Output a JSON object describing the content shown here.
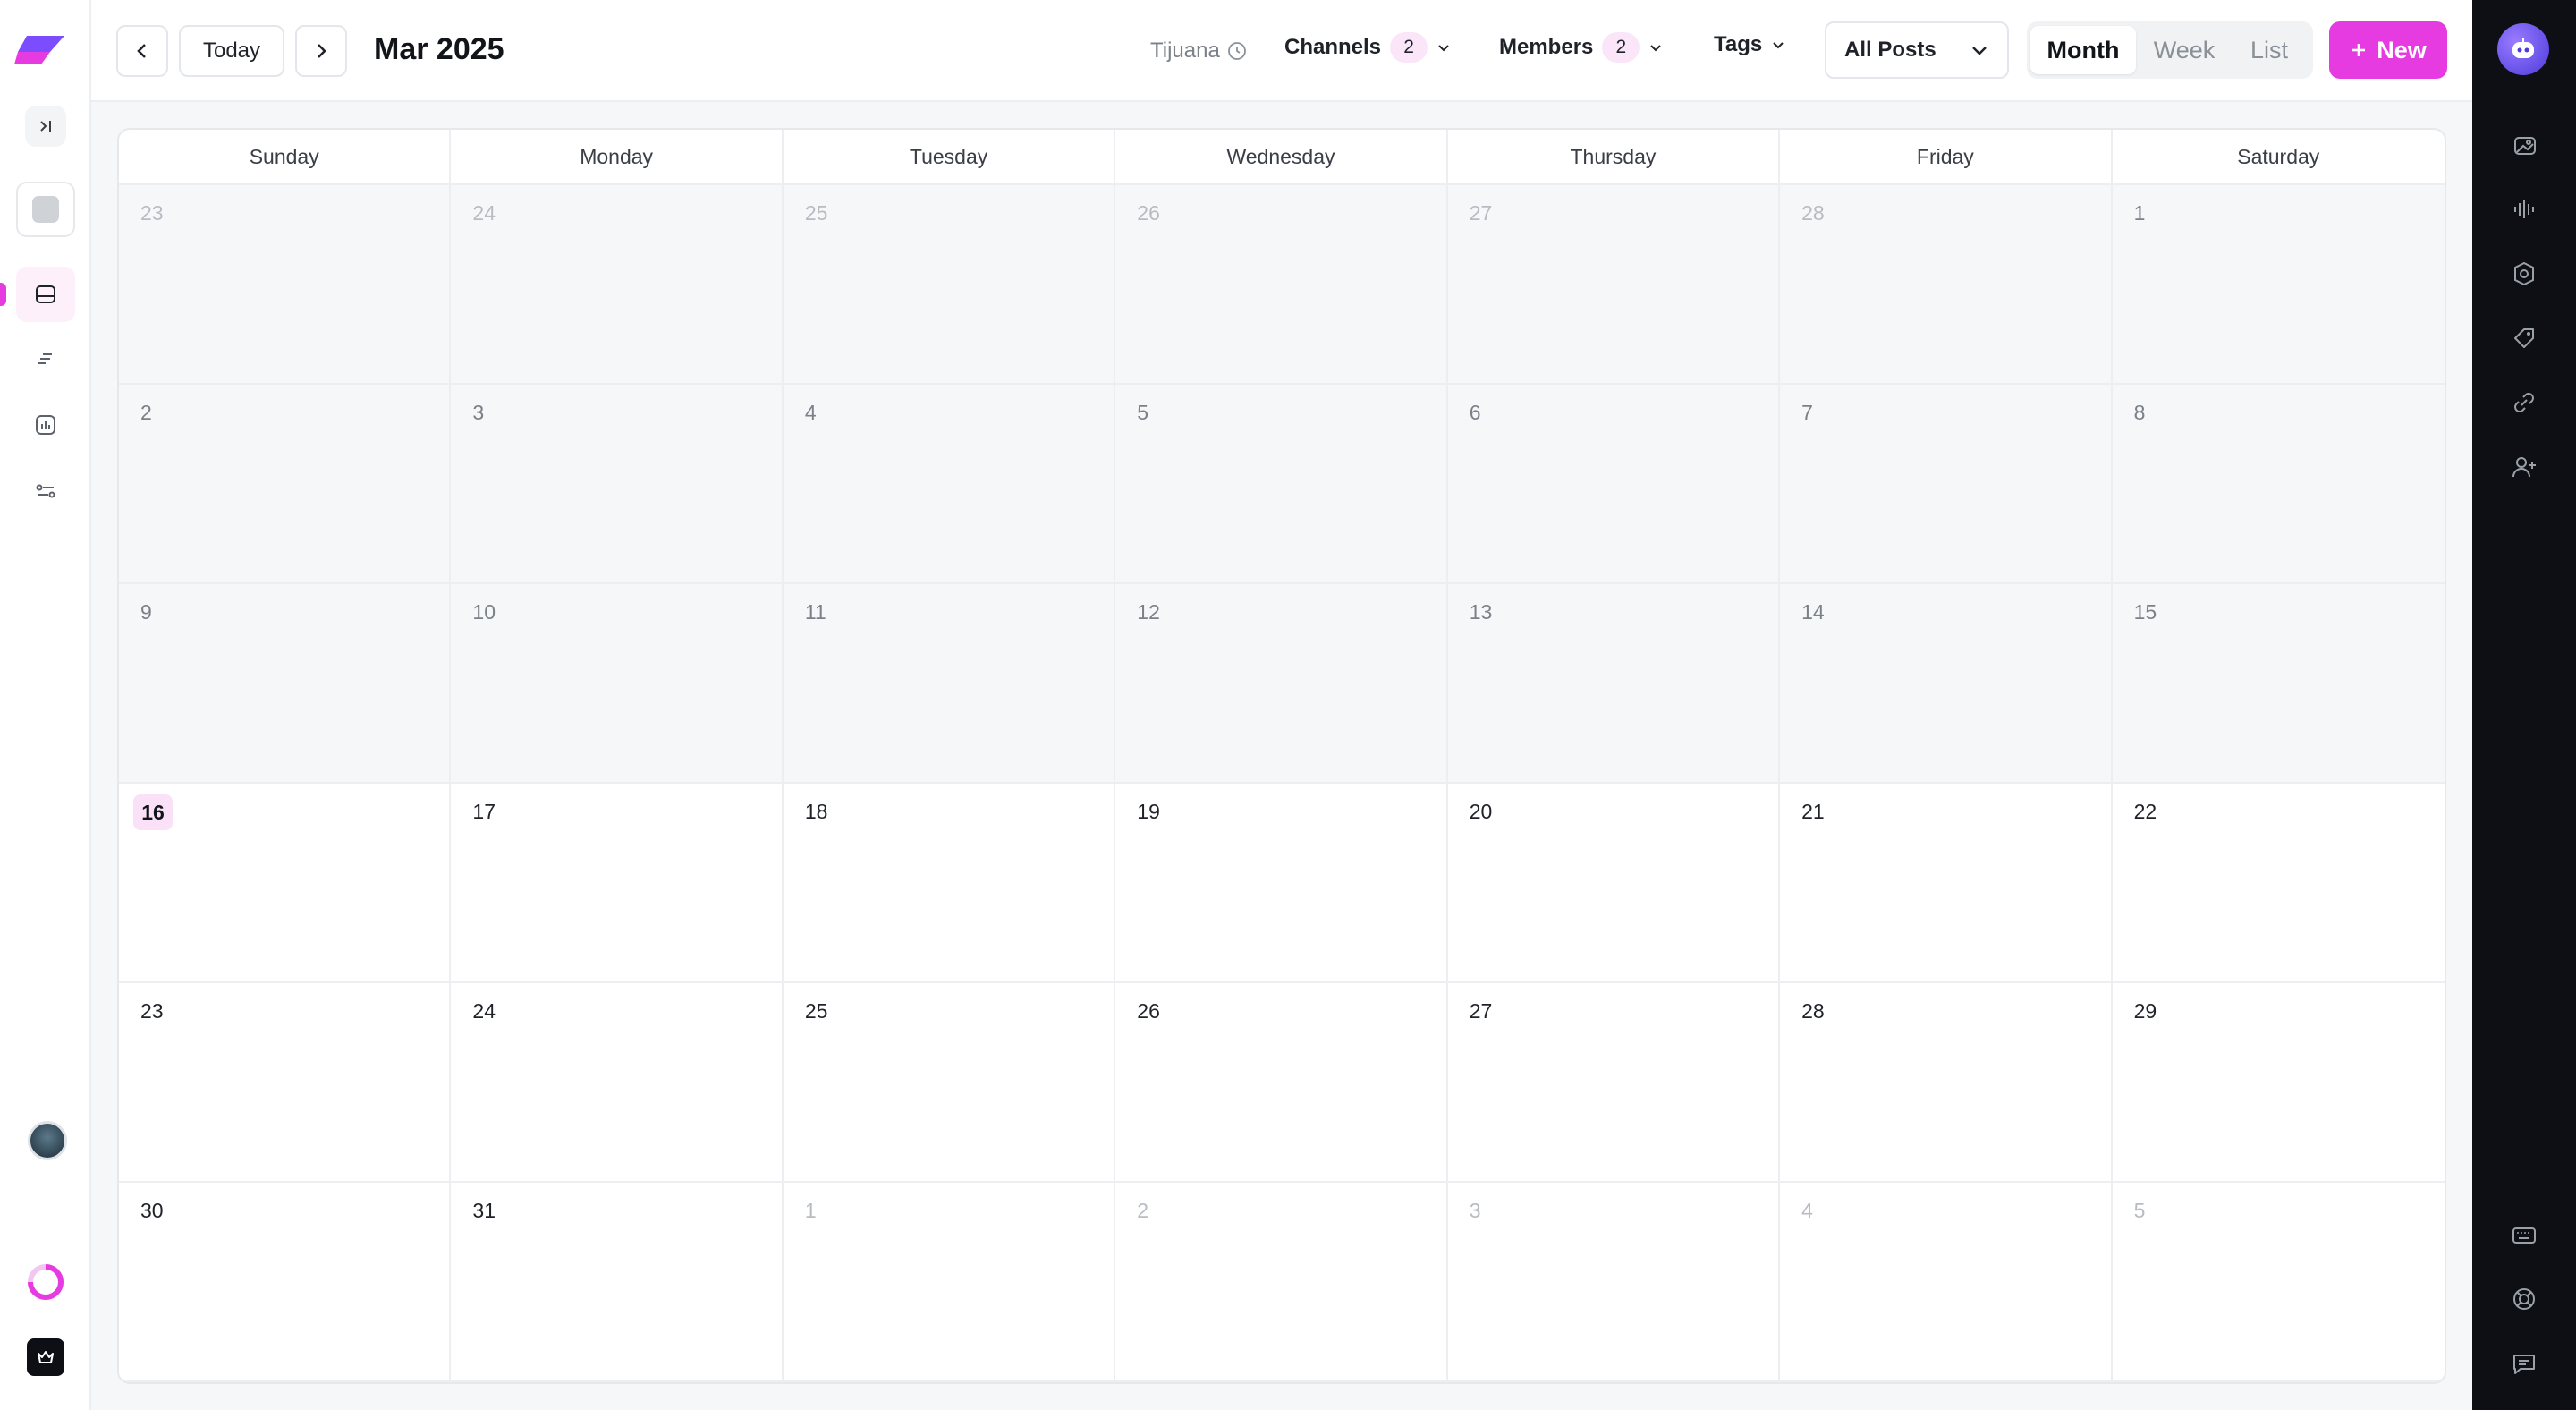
{
  "toolbar": {
    "today_label": "Today",
    "month_title": "Mar 2025",
    "timezone": "Tijuana",
    "channels_label": "Channels",
    "channels_count": "2",
    "members_label": "Members",
    "members_count": "2",
    "tags_label": "Tags",
    "post_filter": "All Posts",
    "view_tabs": [
      "Month",
      "Week",
      "List"
    ],
    "active_view": "Month",
    "new_label": "New"
  },
  "calendar": {
    "weekdays": [
      "Sunday",
      "Monday",
      "Tuesday",
      "Wednesday",
      "Thursday",
      "Friday",
      "Saturday"
    ],
    "today": "16",
    "weeks": [
      [
        "23",
        "24",
        "25",
        "26",
        "27",
        "28",
        "1"
      ],
      [
        "2",
        "3",
        "4",
        "5",
        "6",
        "7",
        "8"
      ],
      [
        "9",
        "10",
        "11",
        "12",
        "13",
        "14",
        "15"
      ],
      [
        "16",
        "17",
        "18",
        "19",
        "20",
        "21",
        "22"
      ],
      [
        "23",
        "24",
        "25",
        "26",
        "27",
        "28",
        "29"
      ],
      [
        "30",
        "31",
        "1",
        "2",
        "3",
        "4",
        "5"
      ]
    ]
  },
  "colors": {
    "accent": "#e53be0",
    "accent_soft": "#fbe1f7",
    "rail_bg": "#0d0f14"
  },
  "icons": {
    "left_nav": [
      "inbox-icon",
      "list-icon",
      "analytics-icon",
      "settings-sliders-icon"
    ],
    "right_rail_top": [
      "media-icon",
      "audio-wave-icon",
      "badge-icon",
      "tag-icon",
      "link-icon",
      "add-user-icon"
    ],
    "right_rail_bottom": [
      "keyboard-icon",
      "help-lifebuoy-icon",
      "chat-icon"
    ]
  }
}
